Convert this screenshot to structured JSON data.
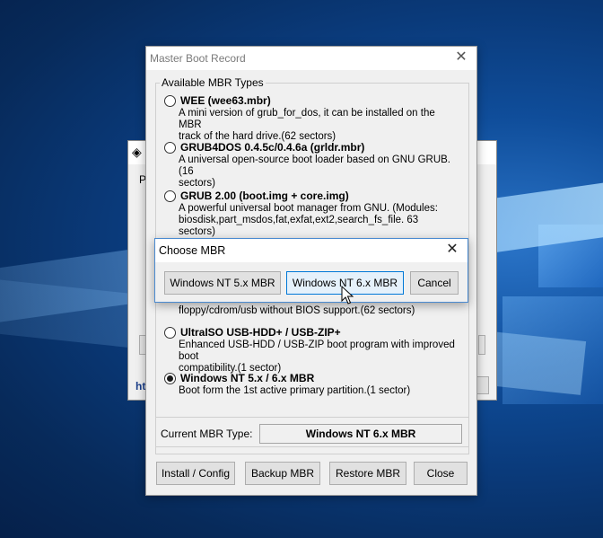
{
  "background_window": {
    "label_fragment": "Pl",
    "link_fragment": "htt"
  },
  "main_window": {
    "title": "Master Boot Record",
    "group_title": "Available MBR Types",
    "options": [
      {
        "title": "WEE (wee63.mbr)",
        "desc": "A mini version of grub_for_dos, it can be installed on the MBR\ntrack of the hard drive.(62 sectors)",
        "checked": false
      },
      {
        "title": "GRUB4DOS 0.4.5c/0.4.6a (grldr.mbr)",
        "desc": "A universal open-source boot loader based on GNU GRUB.(16\nsectors)",
        "checked": false
      },
      {
        "title": "GRUB 2.00 (boot.img + core.img)",
        "desc": "A powerful universal boot manager from GNU. (Modules:\nbiosdisk,part_msdos,fat,exfat,ext2,search_fs_file. 63 sectors)",
        "checked": false
      },
      {
        "title": "UltraISO USB-HDD+ / USB-ZIP+",
        "desc": "Enhanced USB-HDD / USB-ZIP boot program with improved boot\ncompatibility.(1 sector)",
        "checked": false
      },
      {
        "title": "Windows NT 5.x / 6.x MBR",
        "desc": "Boot form the 1st active primary partition.(1 sector)",
        "checked": true
      }
    ],
    "partial_desc": "floppy/cdrom/usb without BIOS support.(62 sectors)",
    "current_label": "Current MBR Type:",
    "current_value": "Windows NT 6.x MBR",
    "buttons": {
      "install": "Install / Config",
      "backup": "Backup MBR",
      "restore": "Restore MBR",
      "close": "Close"
    }
  },
  "popup": {
    "title": "Choose MBR",
    "buttons": {
      "nt5": "Windows NT 5.x MBR",
      "nt6": "Windows NT 6.x MBR",
      "cancel": "Cancel"
    }
  },
  "icons": {
    "close": "close-icon",
    "radio": "radio-button",
    "app": "app-icon",
    "cursor": "mouse-cursor-icon"
  },
  "colors": {
    "desktop": "#0a3a7a",
    "dialog_bg": "#f0f0f0",
    "focus_border": "#0078d7"
  }
}
